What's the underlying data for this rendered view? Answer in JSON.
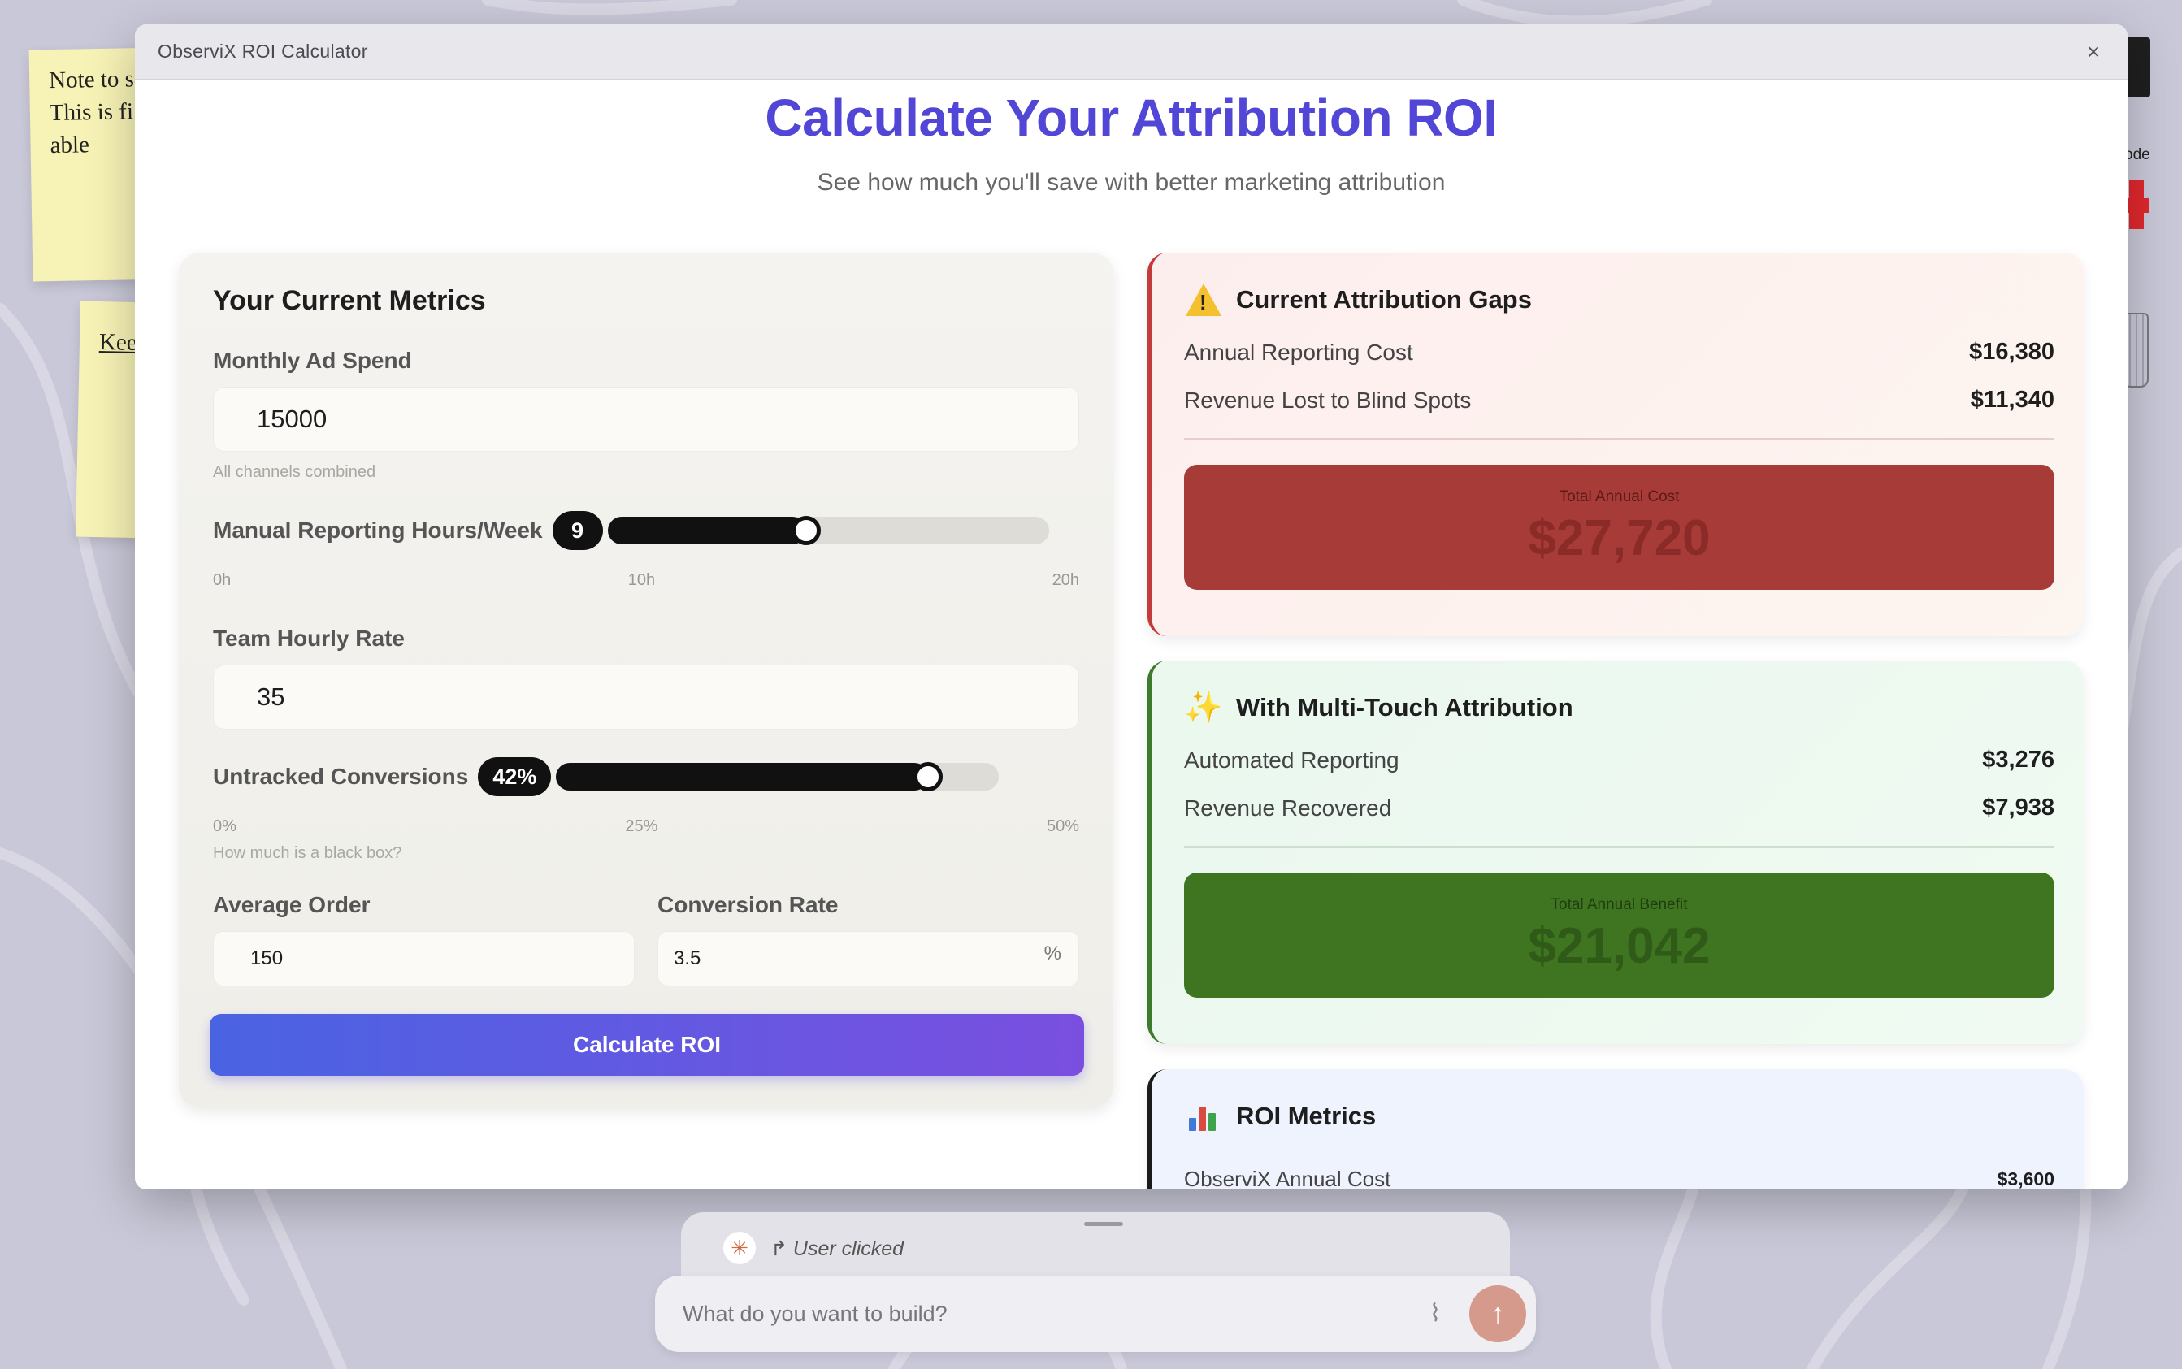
{
  "window": {
    "title": "ObserviX ROI Calculator",
    "close_glyph": "×"
  },
  "hero": {
    "title": "Calculate Your Attribution ROI",
    "subtitle": "See how much you'll save with better marketing attribution"
  },
  "metrics": {
    "title": "Your Current Metrics",
    "ad_spend": {
      "label": "Monthly Ad Spend",
      "value": "15000",
      "hint": "All channels combined"
    },
    "hours": {
      "label": "Manual Reporting Hours/Week",
      "value": "9",
      "min": 0,
      "max": 20,
      "ticks": [
        "0h",
        "10h",
        "20h"
      ]
    },
    "hourly_rate": {
      "label": "Team Hourly Rate",
      "value": "35"
    },
    "untracked": {
      "label": "Untracked Conversions",
      "value": "42%",
      "min": 0,
      "max": 50,
      "current": 42,
      "ticks": [
        "0%",
        "25%",
        "50%"
      ],
      "hint": "How much is a black box?"
    },
    "avg_order": {
      "label": "Average Order",
      "value": "150"
    },
    "conversion_rate": {
      "label": "Conversion Rate",
      "value": "3.5",
      "suffix": "%"
    },
    "cta": "Calculate ROI"
  },
  "gaps": {
    "title": "Current Attribution Gaps",
    "rows": [
      {
        "label": "Annual Reporting Cost",
        "value": "$16,380"
      },
      {
        "label": "Revenue Lost to Blind Spots",
        "value": "$11,340"
      }
    ],
    "total_label": "Total Annual Cost",
    "total_value": "$27,720"
  },
  "multi": {
    "title": "With Multi-Touch Attribution",
    "rows": [
      {
        "label": "Automated Reporting",
        "value": "$3,276"
      },
      {
        "label": "Revenue Recovered",
        "value": "$7,938"
      }
    ],
    "total_label": "Total Annual Benefit",
    "total_value": "$21,042"
  },
  "roi": {
    "title": "ROI Metrics",
    "rows": [
      {
        "label": "ObserviX Annual Cost",
        "value": "$3,600"
      }
    ]
  },
  "desktop": {
    "sticky_1_text": "Note to s This is fi able",
    "sticky_2_text": "Kee",
    "dock_label": "ode"
  },
  "chat": {
    "event": "User clicked",
    "placeholder": "What do you want to build?"
  },
  "colors": {
    "accent": "#5246d6",
    "gap_accent": "#c23a3a",
    "gain_accent": "#3d7a2b"
  }
}
